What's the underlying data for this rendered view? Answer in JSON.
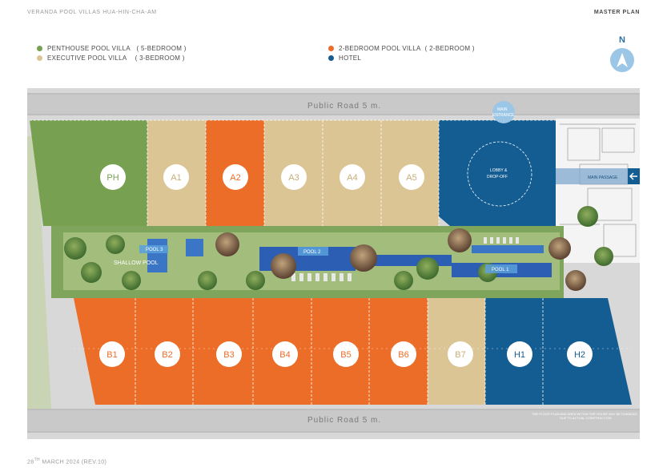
{
  "header": {
    "project": "VERANDA POOL VILLAS HUA-HIN-CHA-AM",
    "section": "MASTER PLAN"
  },
  "legend": [
    {
      "label": "PENTHOUSE POOL VILLA",
      "note": "( 5-BEDROOM )",
      "color": "#77a150"
    },
    {
      "label": "EXECUTIVE POOL VILLA",
      "note": "( 3-BEDROOM )",
      "color": "#dcc595"
    },
    {
      "label": "2-BEDROOM POOL VILLA",
      "note": "( 2-BEDROOM )",
      "color": "#ec6d27"
    },
    {
      "label": "HOTEL",
      "note": "",
      "color": "#145d92"
    }
  ],
  "compass": {
    "label": "N"
  },
  "roads": {
    "top": "Public Road 5 m.",
    "bottom": "Public Road 5 m."
  },
  "units_top": [
    "PH",
    "A1",
    "A2",
    "A3",
    "A4",
    "A5"
  ],
  "units_bottom": [
    "B1",
    "B2",
    "B3",
    "B4",
    "B5",
    "B6",
    "B7",
    "H1",
    "H2"
  ],
  "hotel": {
    "lobby_line1": "LOBBY &",
    "lobby_line2": "DROP-OFF",
    "main_entrance_line1": "MAIN",
    "main_entrance_line2": "ENTRANCE",
    "main_passage": "MAIN PASSAGE"
  },
  "pools": {
    "pool1": "POOL 1",
    "pool2": "POOL 2",
    "pool3": "POOL 3",
    "shallow": "SHALLOW POOL"
  },
  "disclaimer": {
    "line1": "THE FLOOR PLAN AND AREA WITHIN THE HOUSE MAY BE CHANGED",
    "line2": "DUE TO ACTUAL CONSTRUCTION"
  },
  "footer": {
    "day": "28",
    "sup": "TH",
    "rest": " MARCH 2024 (REV.10)"
  }
}
